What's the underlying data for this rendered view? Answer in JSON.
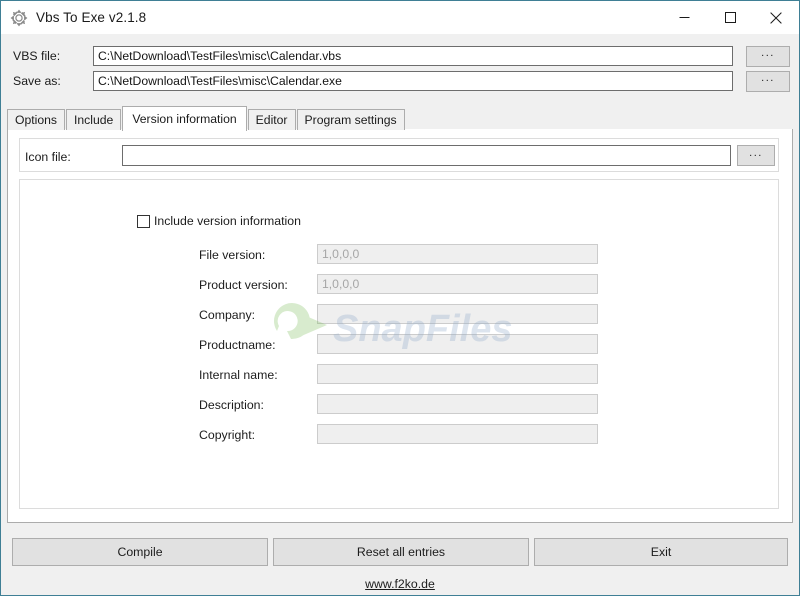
{
  "window": {
    "title": "Vbs To Exe v2.1.8",
    "icon": "gear-icon",
    "border_color": "#3f7f95",
    "controls": {
      "minimize": "minimize-icon",
      "maximize": "maximize-icon",
      "close": "close-icon"
    }
  },
  "top_panel": {
    "vbs_file": {
      "label": "VBS file:",
      "value": "C:\\NetDownload\\TestFiles\\misc\\Calendar.vbs",
      "placeholder": "",
      "browse_label": "..."
    },
    "save_as": {
      "label": "Save as:",
      "value": "C:\\NetDownload\\TestFiles\\misc\\Calendar.exe",
      "placeholder": "",
      "browse_label": "..."
    }
  },
  "tabs": {
    "active_index": 2,
    "items": [
      {
        "label": "Options"
      },
      {
        "label": "Include"
      },
      {
        "label": "Version information"
      },
      {
        "label": "Editor"
      },
      {
        "label": "Program settings"
      }
    ]
  },
  "version_tab": {
    "icon_file": {
      "label": "Icon file:",
      "value": "",
      "placeholder": "",
      "browse_label": "..."
    },
    "include_checkbox": {
      "label": "Include version information",
      "checked": false
    },
    "fields": [
      {
        "label": "File version:",
        "value": "1,0,0,0",
        "enabled": false
      },
      {
        "label": "Product version:",
        "value": "1,0,0,0",
        "enabled": false
      },
      {
        "label": "Company:",
        "value": "",
        "enabled": false
      },
      {
        "label": "Productname:",
        "value": "",
        "enabled": false
      },
      {
        "label": "Internal name:",
        "value": "",
        "enabled": false
      },
      {
        "label": "Description:",
        "value": "",
        "enabled": false
      },
      {
        "label": "Copyright:",
        "value": "",
        "enabled": false
      }
    ]
  },
  "watermark": {
    "text": "SnapFiles",
    "color": "#8fa8c8",
    "logo_color": "#7fbf5f"
  },
  "footer": {
    "buttons": [
      {
        "label": "Compile"
      },
      {
        "label": "Reset all entries"
      },
      {
        "label": "Exit"
      }
    ],
    "link": "www.f2ko.de"
  }
}
